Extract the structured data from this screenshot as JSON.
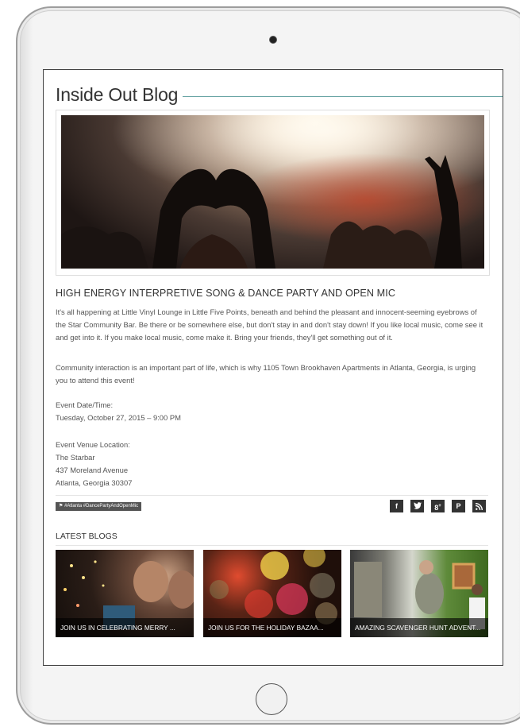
{
  "blog": {
    "title": "Inside Out Blog"
  },
  "post": {
    "title": "HIGH ENERGY INTERPRETIVE SONG & DANCE PARTY AND OPEN MIC",
    "paragraph1": "It's all happening at Little Vinyl Lounge in Little Five Points, beneath and behind the pleasant and innocent-seeming eyebrows of the Star Community Bar. Be there or be somewhere else, but don't stay in and don't stay down! If you like local music, come see it and get into it. If you make local music, come make it. Bring your friends, they'll get something out of it.",
    "paragraph2": "Community interaction is an important part of life, which is why 1105 Town Brookhaven Apartments in Atlanta, Georgia, is urging you to attend this event!",
    "event_date_label": "Event Date/Time:",
    "event_date_value": "Tuesday, October 27, 2015 – 9:00 PM",
    "venue_label": "Event Venue Location:",
    "venue_name": "The Starbar",
    "venue_street": "437 Moreland Avenue",
    "venue_city": "Atlanta, Georgia 30307",
    "tags": "#Atlanta #DancePartyAndOpenMic"
  },
  "share": {
    "facebook": "f",
    "twitter": "t",
    "googleplus": "g+",
    "pinterest": "p",
    "rss": "rss"
  },
  "latest": {
    "heading": "LATEST BLOGS",
    "cards": [
      {
        "caption": "JOIN US IN CELEBRATING MERRY ..."
      },
      {
        "caption": "JOIN US FOR THE HOLIDAY BAZAA..."
      },
      {
        "caption": "AMAZING SCAVENGER HUNT ADVENT..."
      }
    ]
  },
  "colors": {
    "accent_rule": "#6aa6a6",
    "tag_bg": "#555555",
    "share_bg": "#333333"
  }
}
